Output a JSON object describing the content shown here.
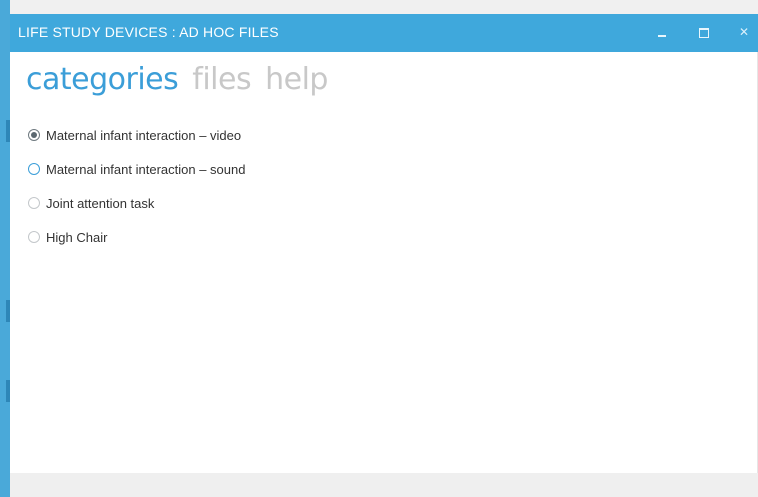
{
  "window": {
    "title": "LIFE STUDY DEVICES : AD HOC FILES",
    "controls": {
      "minimize": "minimize-icon",
      "maximize": "maximize-icon",
      "close": "close-icon"
    }
  },
  "nav": {
    "tabs": [
      {
        "label": "categories",
        "active": true
      },
      {
        "label": "files",
        "active": false
      },
      {
        "label": "help",
        "active": false
      }
    ]
  },
  "categories": {
    "options": [
      {
        "label": "Maternal infant interaction – video",
        "checked": true
      },
      {
        "label": "Maternal infant interaction – sound",
        "checked": false
      },
      {
        "label": "Joint attention task",
        "checked": false
      },
      {
        "label": "High Chair",
        "checked": false
      }
    ]
  },
  "colors": {
    "accent": "#3fa8dc",
    "nav_active": "#3b9ed8",
    "nav_inactive": "#c8c8c8"
  }
}
